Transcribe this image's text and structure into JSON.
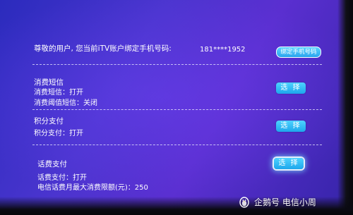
{
  "header": {
    "bound_notice": "尊敬的用户, 您当前iTV账户绑定手机号码:",
    "phone_number": "181****1952",
    "bind_button_label": "绑定手机号码"
  },
  "sections": [
    {
      "title": "消费短信",
      "lines": [
        "消费短信：打开",
        "消费阈值短信：关闭"
      ],
      "select_label": "选 择"
    },
    {
      "title": "积分支付",
      "lines": [
        "积分支付：打开"
      ],
      "select_label": "选 择"
    },
    {
      "title": "话费支付",
      "lines": [
        "话费支付：打开",
        "电信话费月最大消费限额(元)：250"
      ],
      "select_label": "选 择"
    }
  ],
  "watermark": {
    "text": "企鹅号 电信小周",
    "icon": "penguin-icon"
  },
  "colors": {
    "background": "#4b35cf",
    "button": "#2bb6f2",
    "text": "#ffffff"
  }
}
